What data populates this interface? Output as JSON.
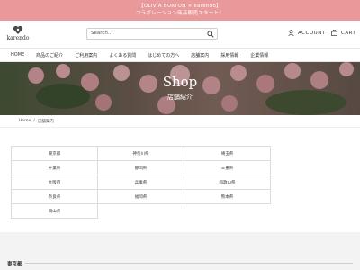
{
  "announcement": {
    "line1": "【OLIVIA BURTON × karendo】",
    "line2": "コラボレーション商品販売スタート！"
  },
  "header": {
    "logo_text": "karendo",
    "search_placeholder": "Search...",
    "account_label": "ACCOUNT",
    "cart_label": "CART"
  },
  "nav": {
    "items": [
      "HOME",
      "商品のご紹介",
      "ご利用案内",
      "よくある質問",
      "はじめての方へ",
      "店舗案内",
      "採用情報",
      "企業情報"
    ]
  },
  "hero": {
    "title": "Shop",
    "subtitle": "店舗紹介"
  },
  "breadcrumb": {
    "home": "Home",
    "separator": "/",
    "current": "店舗案内"
  },
  "stores": {
    "prefectures": [
      "東京都",
      "神奈川県",
      "埼玉県",
      "千葉県",
      "静岡県",
      "三重県",
      "大阪府",
      "兵庫県",
      "和歌山県",
      "奈良県",
      "福岡県",
      "熊本県",
      "岡山県"
    ]
  },
  "section": {
    "title": "東京都"
  },
  "colors": {
    "announcement_bg": "#e9999a",
    "lower_bg": "#f3f3f3"
  }
}
